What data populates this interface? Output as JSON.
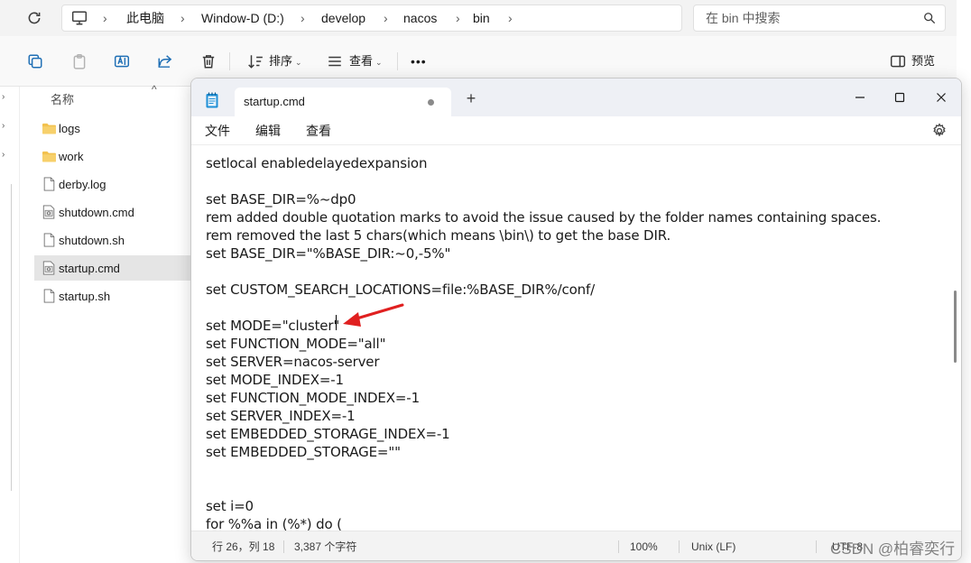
{
  "explorer": {
    "breadcrumb": [
      "此电脑",
      "Window-D (D:)",
      "develop",
      "nacos",
      "bin"
    ],
    "search_placeholder": "在 bin 中搜索",
    "toolbar": {
      "sort_label": "排序",
      "view_label": "查看",
      "more_label": "•••",
      "preview_label": "预览"
    },
    "list_header": "名称",
    "files": [
      {
        "name": "logs",
        "type": "folder"
      },
      {
        "name": "work",
        "type": "folder"
      },
      {
        "name": "derby.log",
        "type": "text"
      },
      {
        "name": "shutdown.cmd",
        "type": "cmd"
      },
      {
        "name": "shutdown.sh",
        "type": "text"
      },
      {
        "name": "startup.cmd",
        "type": "cmd",
        "selected": true
      },
      {
        "name": "startup.sh",
        "type": "text"
      }
    ]
  },
  "notepad": {
    "tab_title": "startup.cmd",
    "new_tab": "+",
    "menu": [
      "文件",
      "编辑",
      "查看"
    ],
    "lines": [
      "setlocal enabledelayedexpansion",
      "",
      "set BASE_DIR=%~dp0",
      "rem added double quotation marks to avoid the issue caused by the folder names containing spaces.",
      "rem removed the last 5 chars(which means \\bin\\) to get the base DIR.",
      "set BASE_DIR=\"%BASE_DIR:~0,-5%\"",
      "",
      "set CUSTOM_SEARCH_LOCATIONS=file:%BASE_DIR%/conf/",
      "",
      "set MODE=\"cluster\"",
      "set FUNCTION_MODE=\"all\"",
      "set SERVER=nacos-server",
      "set MODE_INDEX=-1",
      "set FUNCTION_MODE_INDEX=-1",
      "set SERVER_INDEX=-1",
      "set EMBEDDED_STORAGE_INDEX=-1",
      "set EMBEDDED_STORAGE=\"\"",
      "",
      "",
      "set i=0",
      "for %%a in (%*) do ("
    ],
    "status": {
      "position": "行 26，列 18",
      "chars": "3,387 个字符",
      "zoom": "100%",
      "line_ending": "Unix (LF)",
      "encoding": "UTF-8"
    }
  },
  "watermark": "CSDN @柏睿奕行",
  "colors": {
    "arrow": "#e02020",
    "accent": "#1f6fb5",
    "folder": "#f2c14e"
  }
}
